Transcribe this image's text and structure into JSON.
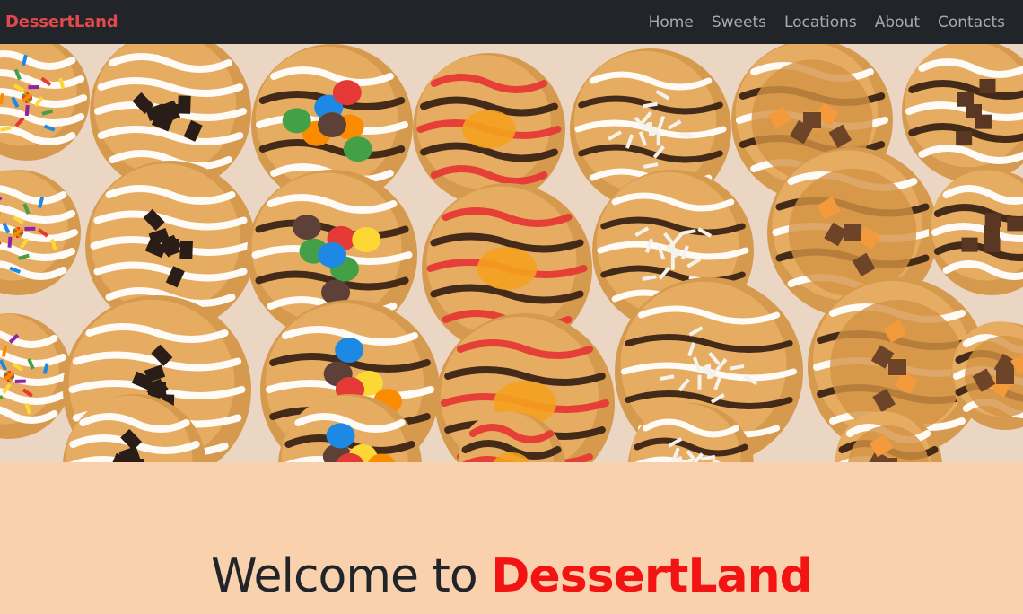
{
  "navbar": {
    "brand": "DessertLand",
    "links": [
      "Home",
      "Sweets",
      "Locations",
      "About",
      "Contacts"
    ]
  },
  "carousel": {
    "image_alt": "Assorted decorated donuts",
    "slide_count": 4,
    "active_index": 2
  },
  "welcome": {
    "prefix": "Welcome to",
    "name": "DessertLand"
  },
  "colors": {
    "navbar_bg": "#212529",
    "brand": "#e5484a",
    "page_bg": "#fad1ad",
    "accent": "#f21313"
  }
}
